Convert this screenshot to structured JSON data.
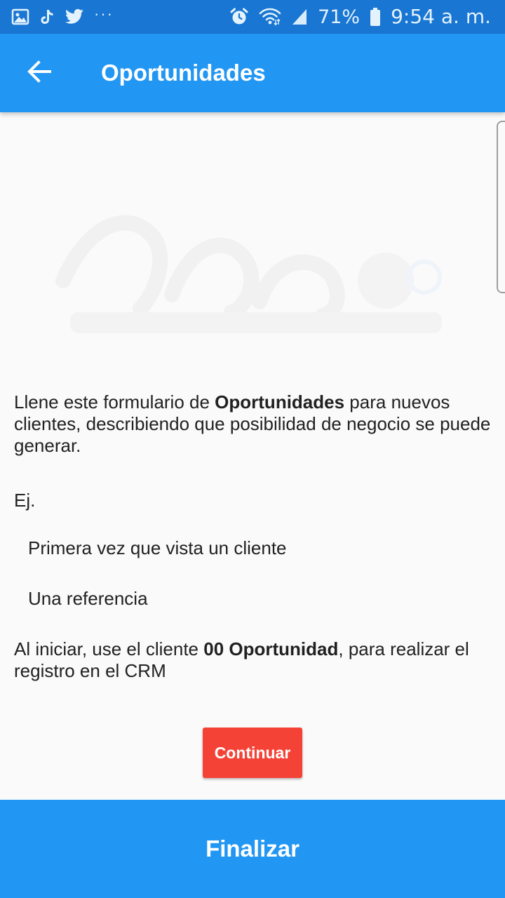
{
  "status_bar": {
    "notification_icons": [
      "gallery-icon",
      "tiktok-icon",
      "twitter-icon"
    ],
    "more_dots": "···",
    "battery_percent": "71%",
    "time": "9:54 a. m.",
    "system_icons": [
      "alarm-icon",
      "wifi-icon",
      "signal-icon",
      "battery-icon"
    ]
  },
  "app_bar": {
    "back_icon": "arrow-back-icon",
    "title": "Oportunidades"
  },
  "content": {
    "logo": {
      "name": "faint-company-logo",
      "color": "#f2f2f2"
    },
    "intro": {
      "prefix": "Llene este formulario de ",
      "bold": "Oportunidades",
      "suffix": " para nuevos clientes, describiendo que posibilidad de negocio se puede generar."
    },
    "example_label": "Ej.",
    "examples": [
      "Primera vez que vista un cliente",
      "Una referencia"
    ],
    "start_note": {
      "prefix": "Al iniciar, use el cliente ",
      "bold": "00 Oportunidad",
      "suffix": ", para realizar el registro en el CRM"
    },
    "continue_label": "Continuar"
  },
  "footer": {
    "finish_label": "Finalizar"
  },
  "colors": {
    "status_bar": "#1976d2",
    "app_bar": "#2196f3",
    "continue_button": "#f44336",
    "background": "#fafafa"
  }
}
